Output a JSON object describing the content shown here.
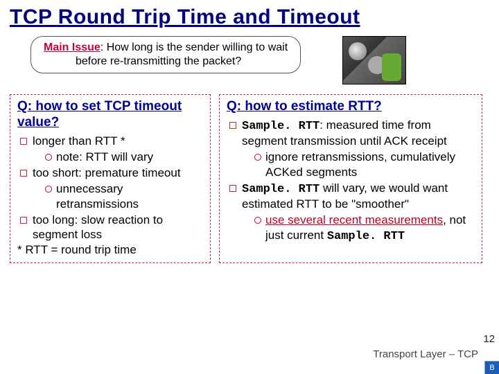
{
  "title": "TCP Round Trip Time and Timeout",
  "issue": {
    "label": "Main Issue",
    "sep": ": ",
    "text1": "How long is the sender willing to wait",
    "text2": "before re-transmitting the packet?"
  },
  "left": {
    "q": "Q: how to set TCP timeout value?",
    "b1": "longer than RTT *",
    "b1s1": "note: RTT will vary",
    "b2": "too short: premature timeout",
    "b2s1": "unnecessary retransmissions",
    "b3": "too long: slow reaction to segment loss",
    "foot": "* RTT = round trip time"
  },
  "right": {
    "q": "Q: how to estimate RTT?",
    "b1a": "Sample. RTT",
    "b1b": ": measured time from segment transmission until ACK receipt",
    "b1s1": "ignore retransmissions, cumulatively ACKed segments",
    "b2a": "Sample. RTT",
    "b2b": " will vary, we would want estimated RTT to be \"smoother\"",
    "b2s1a": "use several recent measurements",
    "b2s1b": ", not just current ",
    "b2s1c": "Sample. RTT"
  },
  "footer": "Transport Layer – TCP",
  "page": "12",
  "corner": "B"
}
